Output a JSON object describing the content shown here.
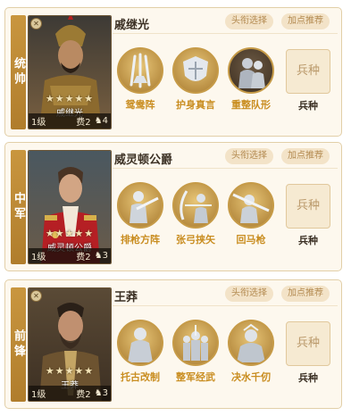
{
  "cards": [
    {
      "role": "统帅",
      "name": "戚继光",
      "portrait_name": "戚继光",
      "stars": "★★★★★",
      "level": "1级",
      "cost": "费2",
      "horse_count": "4",
      "pill_title": "头衔选择",
      "pill_points": "加点推荐",
      "skills": [
        "鸳鸯阵",
        "护身真言",
        "重整队形"
      ],
      "troop_box": "兵种",
      "troop_label": "兵种"
    },
    {
      "role": "中军",
      "name": "威灵顿公爵",
      "portrait_name": "威灵顿公爵",
      "stars": "★★★★★",
      "level": "1级",
      "cost": "费2",
      "horse_count": "3",
      "pill_title": "头衔选择",
      "pill_points": "加点推荐",
      "skills": [
        "排枪方阵",
        "张弓挟矢",
        "回马枪"
      ],
      "troop_box": "兵种",
      "troop_label": "兵种"
    },
    {
      "role": "前锋",
      "name": "王莽",
      "portrait_name": "王莽",
      "stars": "★★★★★",
      "level": "1级",
      "cost": "费2",
      "horse_count": "3",
      "pill_title": "头衔选择",
      "pill_points": "加点推荐",
      "skills": [
        "托古改制",
        "整军经武",
        "决水千仞"
      ],
      "troop_box": "兵种",
      "troop_label": "兵种"
    }
  ],
  "colors": {
    "accent_gold": "#c98d20",
    "role_bar": "#b07d2c",
    "card_bg": "#fdf8ee",
    "pill_bg": "#f3e3c8"
  }
}
